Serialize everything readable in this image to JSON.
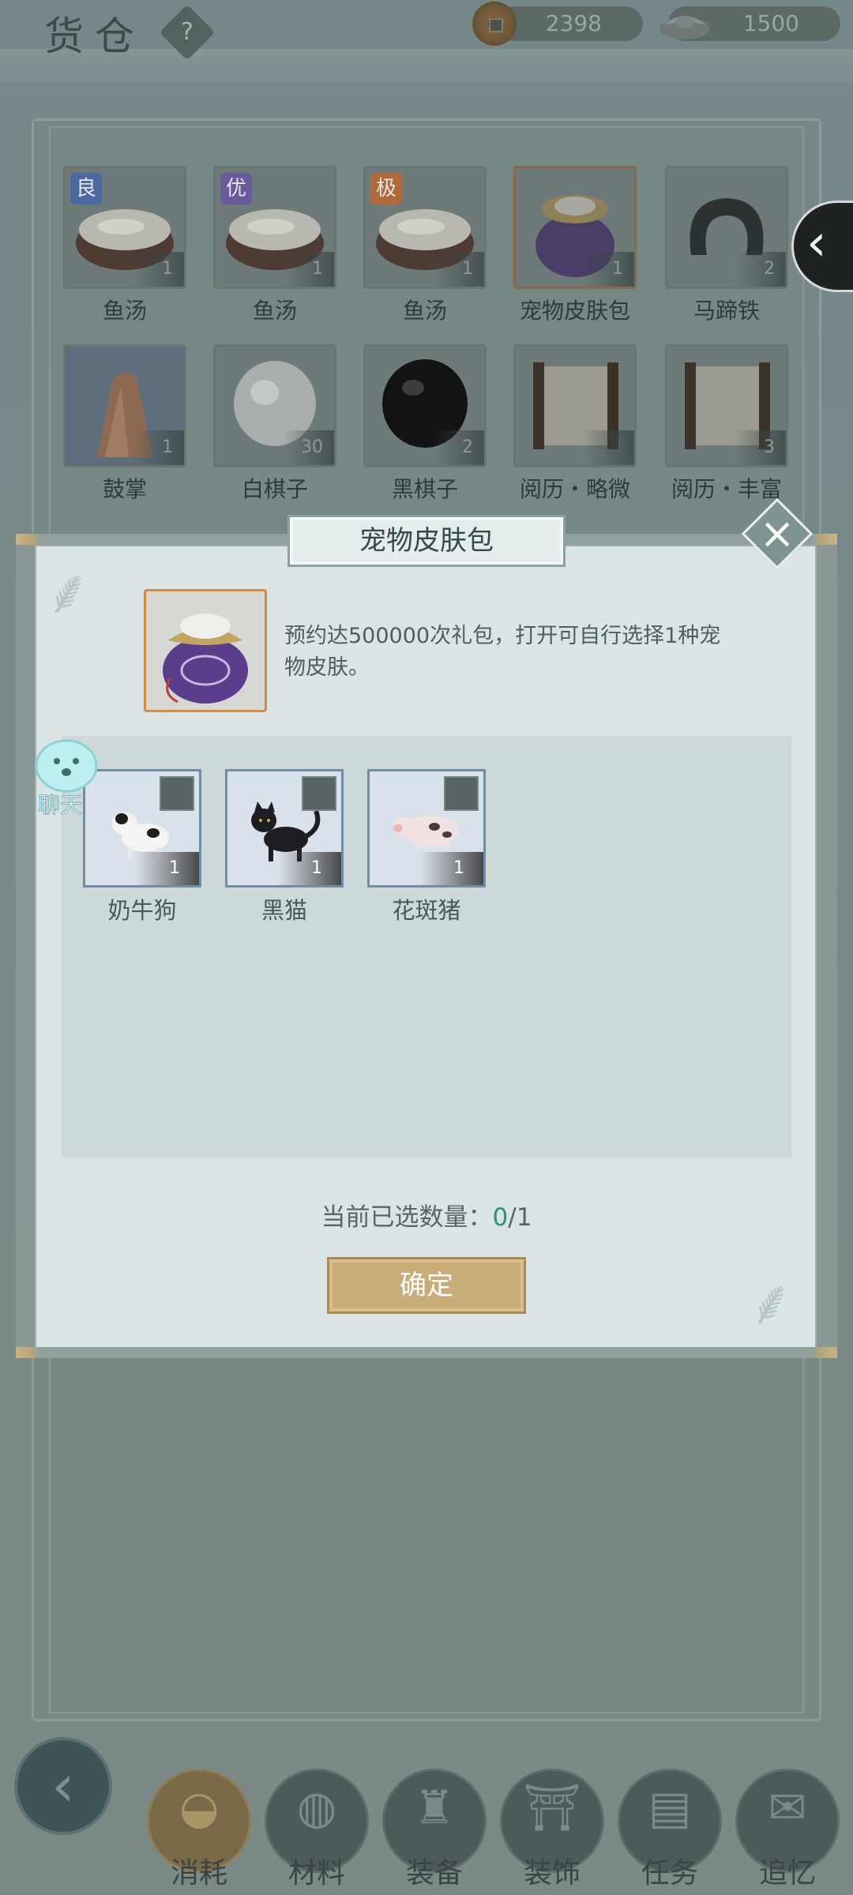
{
  "header": {
    "title": "货仓",
    "help": "?",
    "copper": "2398",
    "silver": "1500"
  },
  "inventory": [
    {
      "name": "鱼汤",
      "count": "1",
      "grade": "良",
      "grade_color": "#4a6aa0",
      "icon": "fish-soup-icon"
    },
    {
      "name": "鱼汤",
      "count": "1",
      "grade": "优",
      "grade_color": "#6a5a9a",
      "icon": "fish-soup-icon"
    },
    {
      "name": "鱼汤",
      "count": "1",
      "grade": "极",
      "grade_color": "#b06a3a",
      "icon": "fish-soup-icon"
    },
    {
      "name": "宠物皮肤包",
      "count": "1",
      "grade": "",
      "icon": "pet-skin-bag-icon"
    },
    {
      "name": "马蹄铁",
      "count": "2",
      "grade": "",
      "icon": "horseshoe-icon"
    },
    {
      "name": "鼓掌",
      "count": "1",
      "grade": "",
      "icon": "clapping-hands-icon"
    },
    {
      "name": "白棋子",
      "count": "30",
      "grade": "",
      "icon": "white-go-stone-icon"
    },
    {
      "name": "黑棋子",
      "count": "2",
      "grade": "",
      "icon": "black-go-stone-icon"
    },
    {
      "name": "阅历・略微",
      "count": "",
      "grade": "",
      "icon": "scroll-icon"
    },
    {
      "name": "阅历・丰富",
      "count": "3",
      "grade": "",
      "icon": "scroll-icon"
    }
  ],
  "modal": {
    "title": "宠物皮肤包",
    "description": "预约达500000次礼包，打开可自行选择1种宠物皮肤。",
    "pets": [
      {
        "name": "奶牛狗",
        "count": "1",
        "icon": "cow-dog-icon"
      },
      {
        "name": "黑猫",
        "count": "1",
        "icon": "black-cat-icon"
      },
      {
        "name": "花斑猪",
        "count": "1",
        "icon": "spotted-pig-icon"
      }
    ],
    "selected_label": "当前已选数量：",
    "selected_value": "0",
    "selected_total": "/1",
    "confirm": "确定"
  },
  "chat": {
    "label": "聊天"
  },
  "tabs": [
    {
      "label": "消耗",
      "icon": "bowl-icon",
      "active": true
    },
    {
      "label": "材料",
      "icon": "materials-icon",
      "active": false
    },
    {
      "label": "装备",
      "icon": "robe-icon",
      "active": false
    },
    {
      "label": "装饰",
      "icon": "gate-icon",
      "active": false
    },
    {
      "label": "任务",
      "icon": "task-book-icon",
      "active": false
    },
    {
      "label": "追忆",
      "icon": "letter-icon",
      "active": false
    }
  ],
  "colors": {
    "accent_gold": "#c9ad78",
    "selected_count_color": "#2f8f7c",
    "pkg_border": "#d38a45"
  }
}
